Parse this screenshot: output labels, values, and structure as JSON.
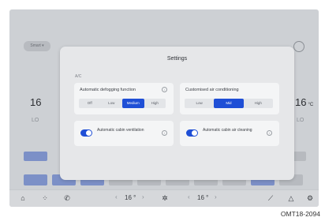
{
  "background": {
    "mode_button": "Smart ▾",
    "left_temp": "16",
    "right_temp": "16",
    "temp_unit": "°C",
    "left_side_label": "LO",
    "right_side_label": "LO"
  },
  "settings": {
    "title": "Settings",
    "section": "A/C",
    "defog": {
      "title": "Automatic defogging function",
      "options": [
        "Off",
        "Low",
        "Medium",
        "High"
      ],
      "selected": "Medium"
    },
    "custom_ac": {
      "title": "Customised air conditioning",
      "options": [
        "Low",
        "Mid",
        "High"
      ],
      "selected": "Mid"
    },
    "cabin_ventilation": {
      "label": "Automatic cabin ventilation",
      "enabled": true
    },
    "cabin_cleaning": {
      "label": "Automatic cabin air cleaning",
      "enabled": true
    }
  },
  "statusbar": {
    "left_temp": "16 °",
    "right_temp": "16 °",
    "icons": [
      "home-icon",
      "apps-icon",
      "phone-icon",
      "fan-icon",
      "seat-icon",
      "warning-icon",
      "settings-icon"
    ]
  },
  "caption": "OMT18-2094",
  "colors": {
    "accent": "#1f4fd6",
    "background": "#cdd0d4",
    "modal": "#e6e7e9"
  }
}
